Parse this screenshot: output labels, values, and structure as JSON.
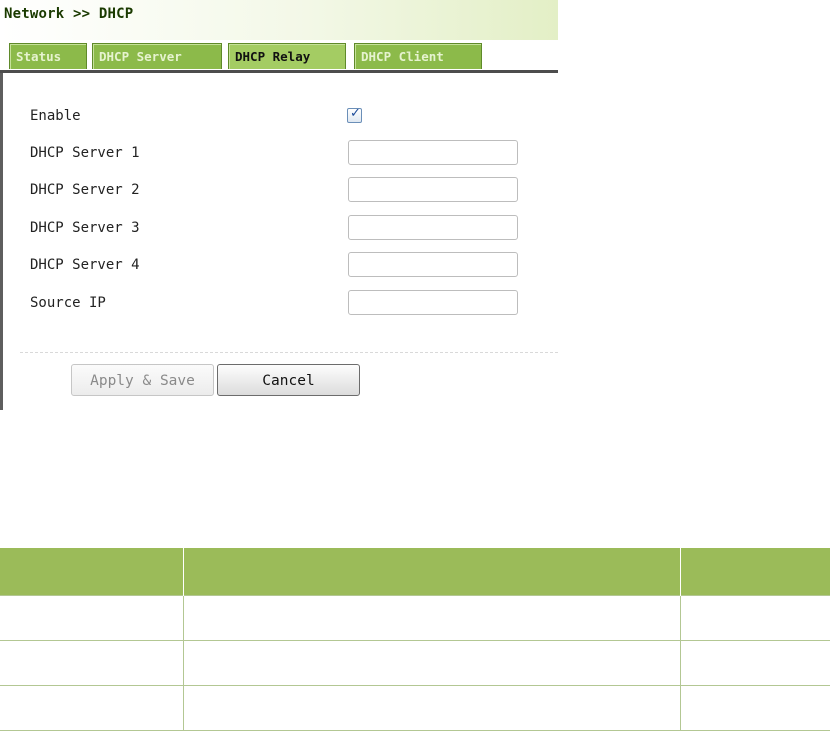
{
  "breadcrumb": "Network >> DHCP",
  "tabs": [
    {
      "label": "Status",
      "active": false
    },
    {
      "label": "DHCP Server",
      "active": false
    },
    {
      "label": "DHCP Relay",
      "active": true
    },
    {
      "label": "DHCP Client",
      "active": false
    }
  ],
  "form": {
    "enable_label": "Enable",
    "enable_checked": true,
    "fields": [
      {
        "label": "DHCP Server 1",
        "value": ""
      },
      {
        "label": "DHCP Server 2",
        "value": ""
      },
      {
        "label": "DHCP Server 3",
        "value": ""
      },
      {
        "label": "DHCP Server 4",
        "value": ""
      },
      {
        "label": "Source IP",
        "value": ""
      }
    ]
  },
  "buttons": {
    "apply_save": "Apply & Save",
    "cancel": "Cancel"
  },
  "colors": {
    "tab_bg": "#8cba4a",
    "tab_active_bg": "#a4cc63",
    "table_header_bg": "#9bbb59",
    "table_border": "#b3c793"
  }
}
